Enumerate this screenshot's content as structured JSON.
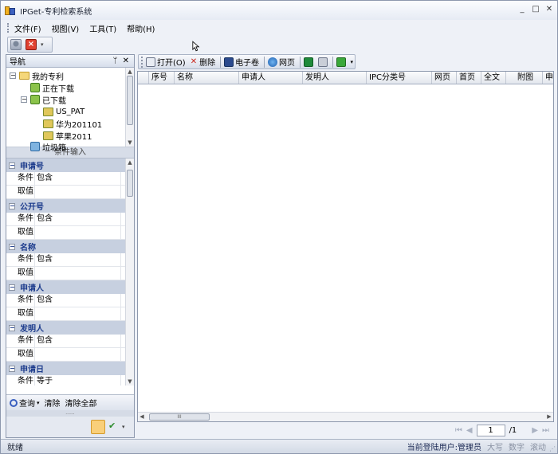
{
  "window": {
    "title": "IPGet-专利检索系统",
    "controls": [
      "_",
      "□",
      "✕"
    ]
  },
  "menu": [
    "文件(F)",
    "视图(V)",
    "工具(T)",
    "帮助(H)"
  ],
  "nav": {
    "title": "导航",
    "pin": "ᛘ",
    "close": "✕",
    "tree": [
      {
        "label": "我的专利",
        "toggle": "−",
        "icon": "folder-icon"
      },
      {
        "label": "正在下载",
        "icon": "downloading-icon"
      },
      {
        "label": "已下载",
        "toggle": "−",
        "icon": "downloaded-icon"
      },
      {
        "label": "US_PAT",
        "icon": "patent-icon"
      },
      {
        "label": "华为201101",
        "icon": "patent-icon"
      },
      {
        "label": "苹果2011",
        "icon": "patent-icon"
      },
      {
        "label": "垃圾箱",
        "icon": "trash-icon"
      }
    ],
    "condition_header": "条件输入",
    "categories": [
      {
        "name": "申请号",
        "cond_key": "条件",
        "cond_val": "包含",
        "value_key": "取值"
      },
      {
        "name": "公开号",
        "cond_key": "条件",
        "cond_val": "包含",
        "value_key": "取值"
      },
      {
        "name": "名称",
        "cond_key": "条件",
        "cond_val": "包含",
        "value_key": "取值"
      },
      {
        "name": "申请人",
        "cond_key": "条件",
        "cond_val": "包含",
        "value_key": "取值"
      },
      {
        "name": "发明人",
        "cond_key": "条件",
        "cond_val": "包含",
        "value_key": "取值"
      },
      {
        "name": "申请日",
        "cond_key": "条件",
        "cond_val": "等于"
      }
    ],
    "query": {
      "search": "查询",
      "dropdown": "▾",
      "clear": "清除",
      "clear_all": "清除全部"
    },
    "splitter": "......"
  },
  "toolbar": {
    "open": "打开(O)",
    "delete": "删除",
    "ebook": "电子卷",
    "web": "网页"
  },
  "grid": {
    "columns": [
      "序号",
      "名称",
      "申请人",
      "发明人",
      "IPC分类号",
      "网页",
      "首页",
      "全文",
      "附图",
      "申"
    ],
    "hscroll_thumb": "III"
  },
  "pager": {
    "page": "1",
    "total": "/1"
  },
  "status": {
    "left": "就绪",
    "user": "当前登陆用户:管理员",
    "caps": "大写",
    "num": "数字",
    "scroll": "滚动"
  }
}
